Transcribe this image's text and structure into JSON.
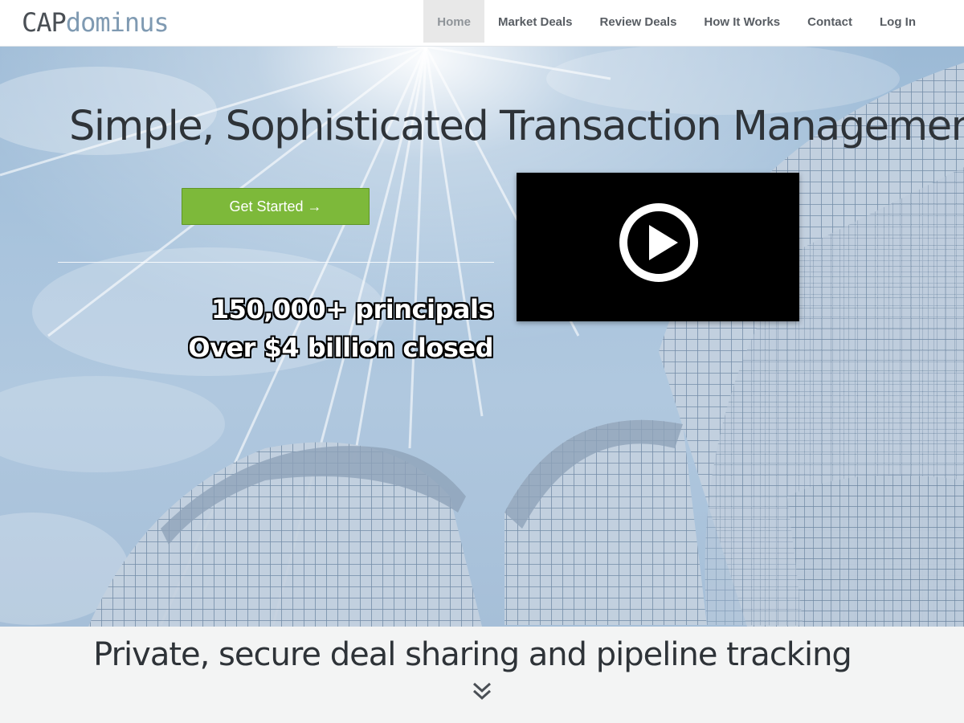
{
  "brand": {
    "part1": "CAP",
    "part2": "dominus",
    "accent": "#7f9ab2"
  },
  "nav": {
    "items": [
      {
        "label": "Home",
        "active": true
      },
      {
        "label": "Market Deals",
        "active": false
      },
      {
        "label": "Review Deals",
        "active": false
      },
      {
        "label": "How It Works",
        "active": false
      },
      {
        "label": "Contact",
        "active": false
      },
      {
        "label": "Log In",
        "active": false
      }
    ]
  },
  "hero": {
    "title": "Simple, Sophisticated Transaction Management",
    "cta_label": "Get Started →",
    "cta_color": "#7db93a",
    "stats": [
      "150,000+ principals",
      "Over $4 billion closed"
    ],
    "video": {
      "icon": "play-icon"
    }
  },
  "band": {
    "tagline": "Private, secure deal sharing and pipeline tracking",
    "scroll_icon": "double-chevron-down-icon"
  }
}
